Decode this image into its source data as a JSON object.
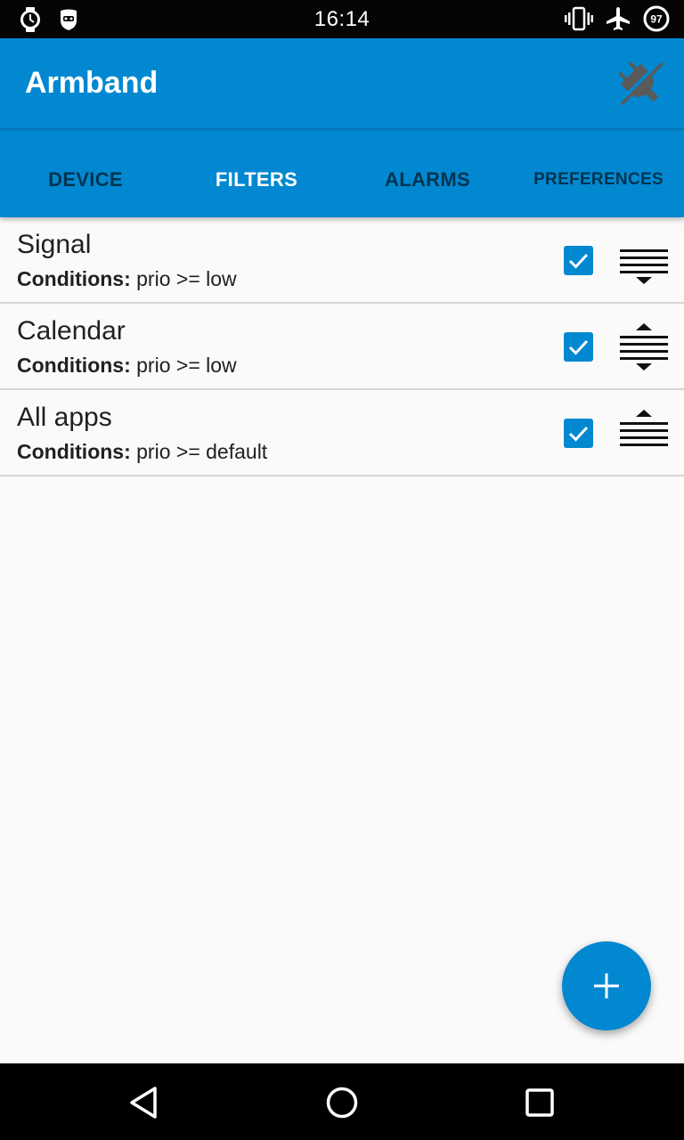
{
  "status_bar": {
    "time": "16:14",
    "battery_level": "97",
    "icons_left": [
      "watch-icon",
      "robot-face-icon"
    ],
    "icons_right": [
      "vibrate-icon",
      "airplane-icon",
      "battery-icon"
    ]
  },
  "app_bar": {
    "title": "Armband",
    "action_icon": "plug-disconnected-icon"
  },
  "tabs": [
    {
      "label": "DEVICE",
      "active": false
    },
    {
      "label": "FILTERS",
      "active": true
    },
    {
      "label": "ALARMS",
      "active": false
    },
    {
      "label": "PREFERENCES",
      "active": false
    }
  ],
  "filters": [
    {
      "name": "Signal",
      "conditions_label": "Conditions:",
      "conditions_value": "prio >= low",
      "enabled": true,
      "move_icon": "move-down-icon"
    },
    {
      "name": "Calendar",
      "conditions_label": "Conditions:",
      "conditions_value": "prio >= low",
      "enabled": true,
      "move_icon": "move-up-down-icon"
    },
    {
      "name": "All apps",
      "conditions_label": "Conditions:",
      "conditions_value": "prio >= default",
      "enabled": true,
      "move_icon": "move-up-icon"
    }
  ],
  "fab": {
    "icon": "plus-icon"
  },
  "nav_bar": {
    "icons": [
      "back-icon",
      "home-icon",
      "recents-icon"
    ]
  },
  "colors": {
    "primary": "#0288d1",
    "status_bar": "#050505",
    "background": "#fafafa"
  }
}
